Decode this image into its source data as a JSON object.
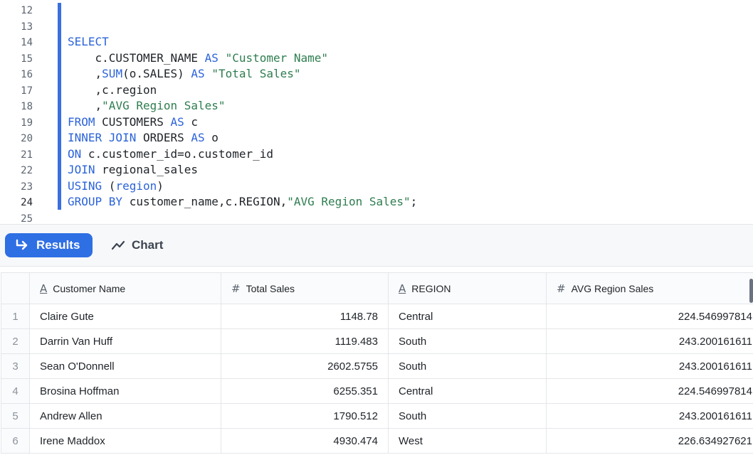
{
  "editor": {
    "line_numbers": [
      "12",
      "13",
      "14",
      "15",
      "16",
      "17",
      "18",
      "19",
      "20",
      "21",
      "22",
      "23",
      "24",
      "25"
    ],
    "active_line": "24",
    "code": {
      "l14": {
        "kw1": "SELECT"
      },
      "l15": {
        "t1": "    c.CUSTOMER_NAME ",
        "kw1": "AS",
        "t2": " ",
        "s1": "\"Customer Name\""
      },
      "l16": {
        "t1": "    ,",
        "kw1": "SUM",
        "t2": "(o.SALES) ",
        "kw2": "AS",
        "t3": " ",
        "s1": "\"Total Sales\""
      },
      "l17": {
        "t1": "    ,c.region"
      },
      "l18": {
        "t1": "    ,",
        "s1": "\"AVG Region Sales\""
      },
      "l19": {
        "kw1": "FROM",
        "t1": " CUSTOMERS ",
        "kw2": "AS",
        "t2": " c"
      },
      "l20": {
        "kw1": "INNER JOIN",
        "t1": " ORDERS ",
        "kw2": "AS",
        "t2": " o"
      },
      "l21": {
        "kw1": "ON",
        "t1": " c.customer_id=o.customer_id"
      },
      "l22": {
        "kw1": "JOIN",
        "t1": " regional_sales"
      },
      "l23": {
        "kw1": "USING",
        "t1": " (",
        "kw2": "region",
        "t2": ")"
      },
      "l24": {
        "kw1": "GROUP BY",
        "t1": " customer_name,c.REGION,",
        "s1": "\"AVG Region Sales\"",
        "t2": ";"
      }
    }
  },
  "toolbar": {
    "results_label": "Results",
    "chart_label": "Chart"
  },
  "table": {
    "columns": [
      {
        "name": "Customer Name",
        "type_icon": "A"
      },
      {
        "name": "Total Sales",
        "type_icon": "#"
      },
      {
        "name": "REGION",
        "type_icon": "A"
      },
      {
        "name": "AVG Region Sales",
        "type_icon": "#"
      }
    ],
    "rows": [
      {
        "idx": "1",
        "name": "Claire Gute",
        "total": "1148.78",
        "region": "Central",
        "avg": "224.546997814"
      },
      {
        "idx": "2",
        "name": "Darrin Van Huff",
        "total": "1119.483",
        "region": "South",
        "avg": "243.200161611"
      },
      {
        "idx": "3",
        "name": "Sean O'Donnell",
        "total": "2602.5755",
        "region": "South",
        "avg": "243.200161611"
      },
      {
        "idx": "4",
        "name": "Brosina Hoffman",
        "total": "6255.351",
        "region": "Central",
        "avg": "224.546997814"
      },
      {
        "idx": "5",
        "name": "Andrew Allen",
        "total": "1790.512",
        "region": "South",
        "avg": "243.200161611"
      },
      {
        "idx": "6",
        "name": "Irene Maddox",
        "total": "4930.474",
        "region": "West",
        "avg": "226.634927621"
      }
    ]
  }
}
